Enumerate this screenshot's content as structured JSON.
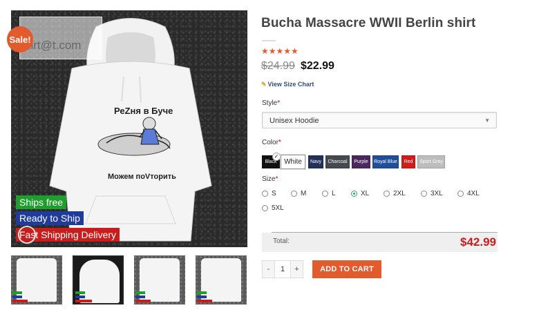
{
  "gallery": {
    "sale_badge": "Sale!",
    "watermark_text": "hirt@t.com",
    "print_title": "РеZня в Буче",
    "print_caption": "Можем поVторить",
    "tags": {
      "ships_free": "Ships free",
      "ready_to_ship": "Ready to Ship",
      "fast_shipping": "Fast Shipping Delivery"
    }
  },
  "product": {
    "title": "Bucha Massacre WWII Berlin shirt",
    "rating_stars": "★★★★★",
    "old_price": "$24.99",
    "new_price": "$22.99",
    "size_chart_link": "View Size Chart"
  },
  "style": {
    "label": "Style",
    "required_mark": "*",
    "selected": "Unisex Hoodie"
  },
  "color": {
    "label": "Color",
    "required_mark": "*",
    "options": [
      {
        "name": "Black",
        "hex": "#111111"
      },
      {
        "name": "White",
        "hex": "#ffffff"
      },
      {
        "name": "Navy",
        "hex": "#22305a"
      },
      {
        "name": "Charcoal",
        "hex": "#444a4f"
      },
      {
        "name": "Purple",
        "hex": "#4a2a5e"
      },
      {
        "name": "Royal Blue",
        "hex": "#1f4f9c"
      },
      {
        "name": "Red",
        "hex": "#d21c1c"
      },
      {
        "name": "Sport Grey",
        "hex": "#bdbdbd"
      }
    ],
    "selected": "Black"
  },
  "size": {
    "label": "Size",
    "required_mark": "*",
    "options": [
      "S",
      "M",
      "L",
      "XL",
      "2XL",
      "3XL",
      "4XL",
      "5XL"
    ],
    "selected": "XL"
  },
  "total": {
    "label": "Total:",
    "amount": "$42.99"
  },
  "cart": {
    "minus": "-",
    "quantity": "1",
    "plus": "+",
    "add_label": "ADD TO CART"
  },
  "colors": {
    "accent": "#e25b2d",
    "price_red": "#c81d1d"
  }
}
